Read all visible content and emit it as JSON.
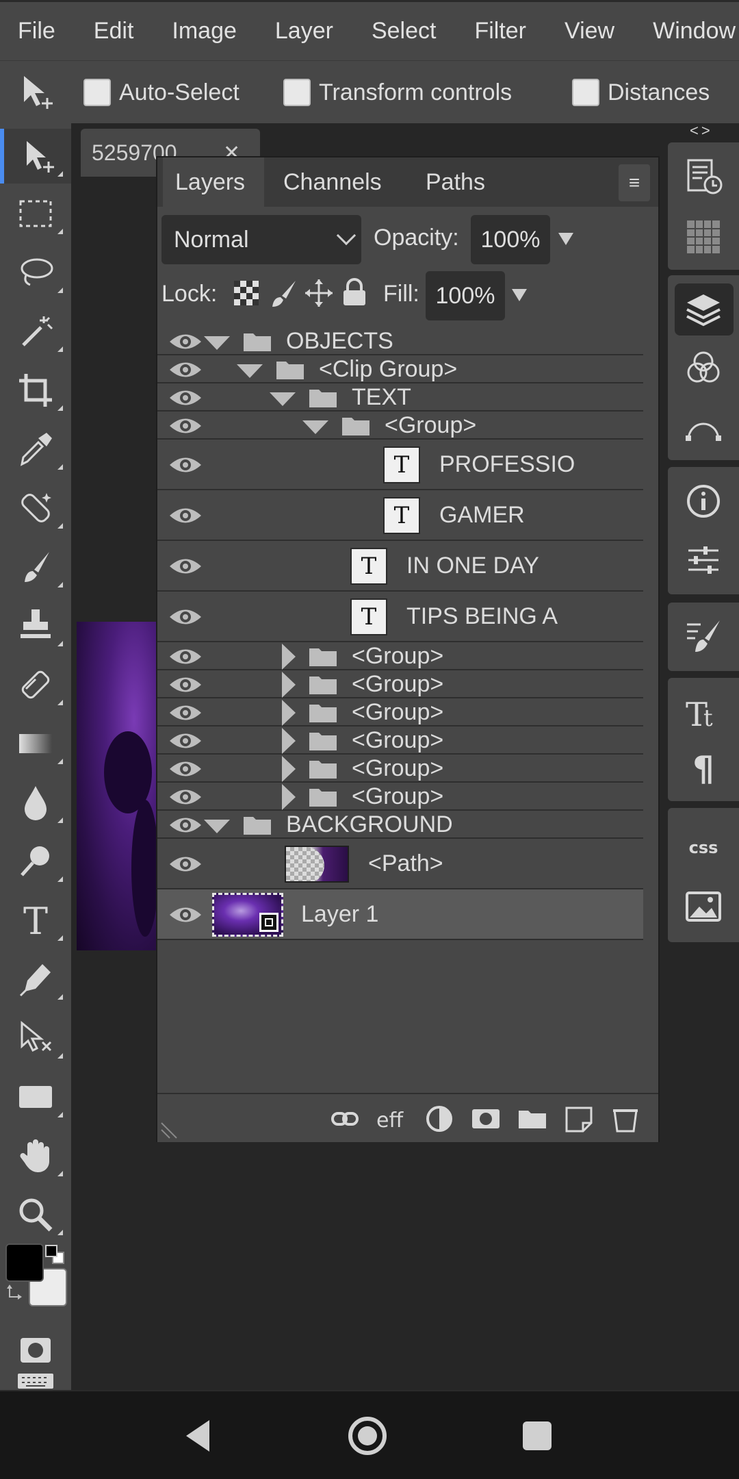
{
  "menu": {
    "items": [
      "File",
      "Edit",
      "Image",
      "Layer",
      "Select",
      "Filter",
      "View",
      "Window"
    ]
  },
  "options": {
    "auto_select": "Auto-Select",
    "transform_controls": "Transform controls",
    "distances": "Distances"
  },
  "document": {
    "tab_name": "5259700",
    "close_glyph": "✕"
  },
  "right_panel": {
    "collapse_glyph": "<>"
  },
  "layers_panel": {
    "tabs": [
      "Layers",
      "Channels",
      "Paths"
    ],
    "menu_glyph": "≡",
    "blend_mode": "Normal",
    "opacity_label": "Opacity:",
    "opacity_value": "100%",
    "lock_label": "Lock:",
    "fill_label": "Fill:",
    "fill_value": "100%",
    "layers": [
      {
        "name": "OBJECTS",
        "kind": "folder",
        "expanded": true,
        "depth": 0
      },
      {
        "name": "<Clip Group>",
        "kind": "folder",
        "expanded": true,
        "depth": 1
      },
      {
        "name": "TEXT",
        "kind": "folder",
        "expanded": true,
        "depth": 2
      },
      {
        "name": "<Group>",
        "kind": "folder",
        "expanded": true,
        "depth": 3
      },
      {
        "name": "PROFESSIO",
        "kind": "text",
        "depth": 4
      },
      {
        "name": "GAMER",
        "kind": "text",
        "depth": 4
      },
      {
        "name": "IN ONE DAY",
        "kind": "text",
        "depth": 3
      },
      {
        "name": "TIPS BEING A",
        "kind": "text",
        "depth": 3
      },
      {
        "name": "<Group>",
        "kind": "folder",
        "expanded": false,
        "depth": 2
      },
      {
        "name": "<Group>",
        "kind": "folder",
        "expanded": false,
        "depth": 2
      },
      {
        "name": "<Group>",
        "kind": "folder",
        "expanded": false,
        "depth": 2
      },
      {
        "name": "<Group>",
        "kind": "folder",
        "expanded": false,
        "depth": 2
      },
      {
        "name": "<Group>",
        "kind": "folder",
        "expanded": false,
        "depth": 2
      },
      {
        "name": "<Group>",
        "kind": "folder",
        "expanded": false,
        "depth": 2
      },
      {
        "name": "BACKGROUND",
        "kind": "folder",
        "expanded": true,
        "depth": 0
      },
      {
        "name": "<Path>",
        "kind": "path",
        "depth": 1
      },
      {
        "name": "Layer 1",
        "kind": "image",
        "depth": 0,
        "selected": true
      }
    ],
    "text_thumb_glyph": "T",
    "footer_icon_names": [
      "link-icon",
      "effects-icon",
      "adjustment-icon",
      "mask-icon",
      "new-folder-icon",
      "new-layer-icon",
      "delete-icon"
    ],
    "effects_glyph": "eff"
  },
  "colors": {
    "foreground": "#000000",
    "background": "#ececec",
    "accent": "#4a8cf0"
  }
}
